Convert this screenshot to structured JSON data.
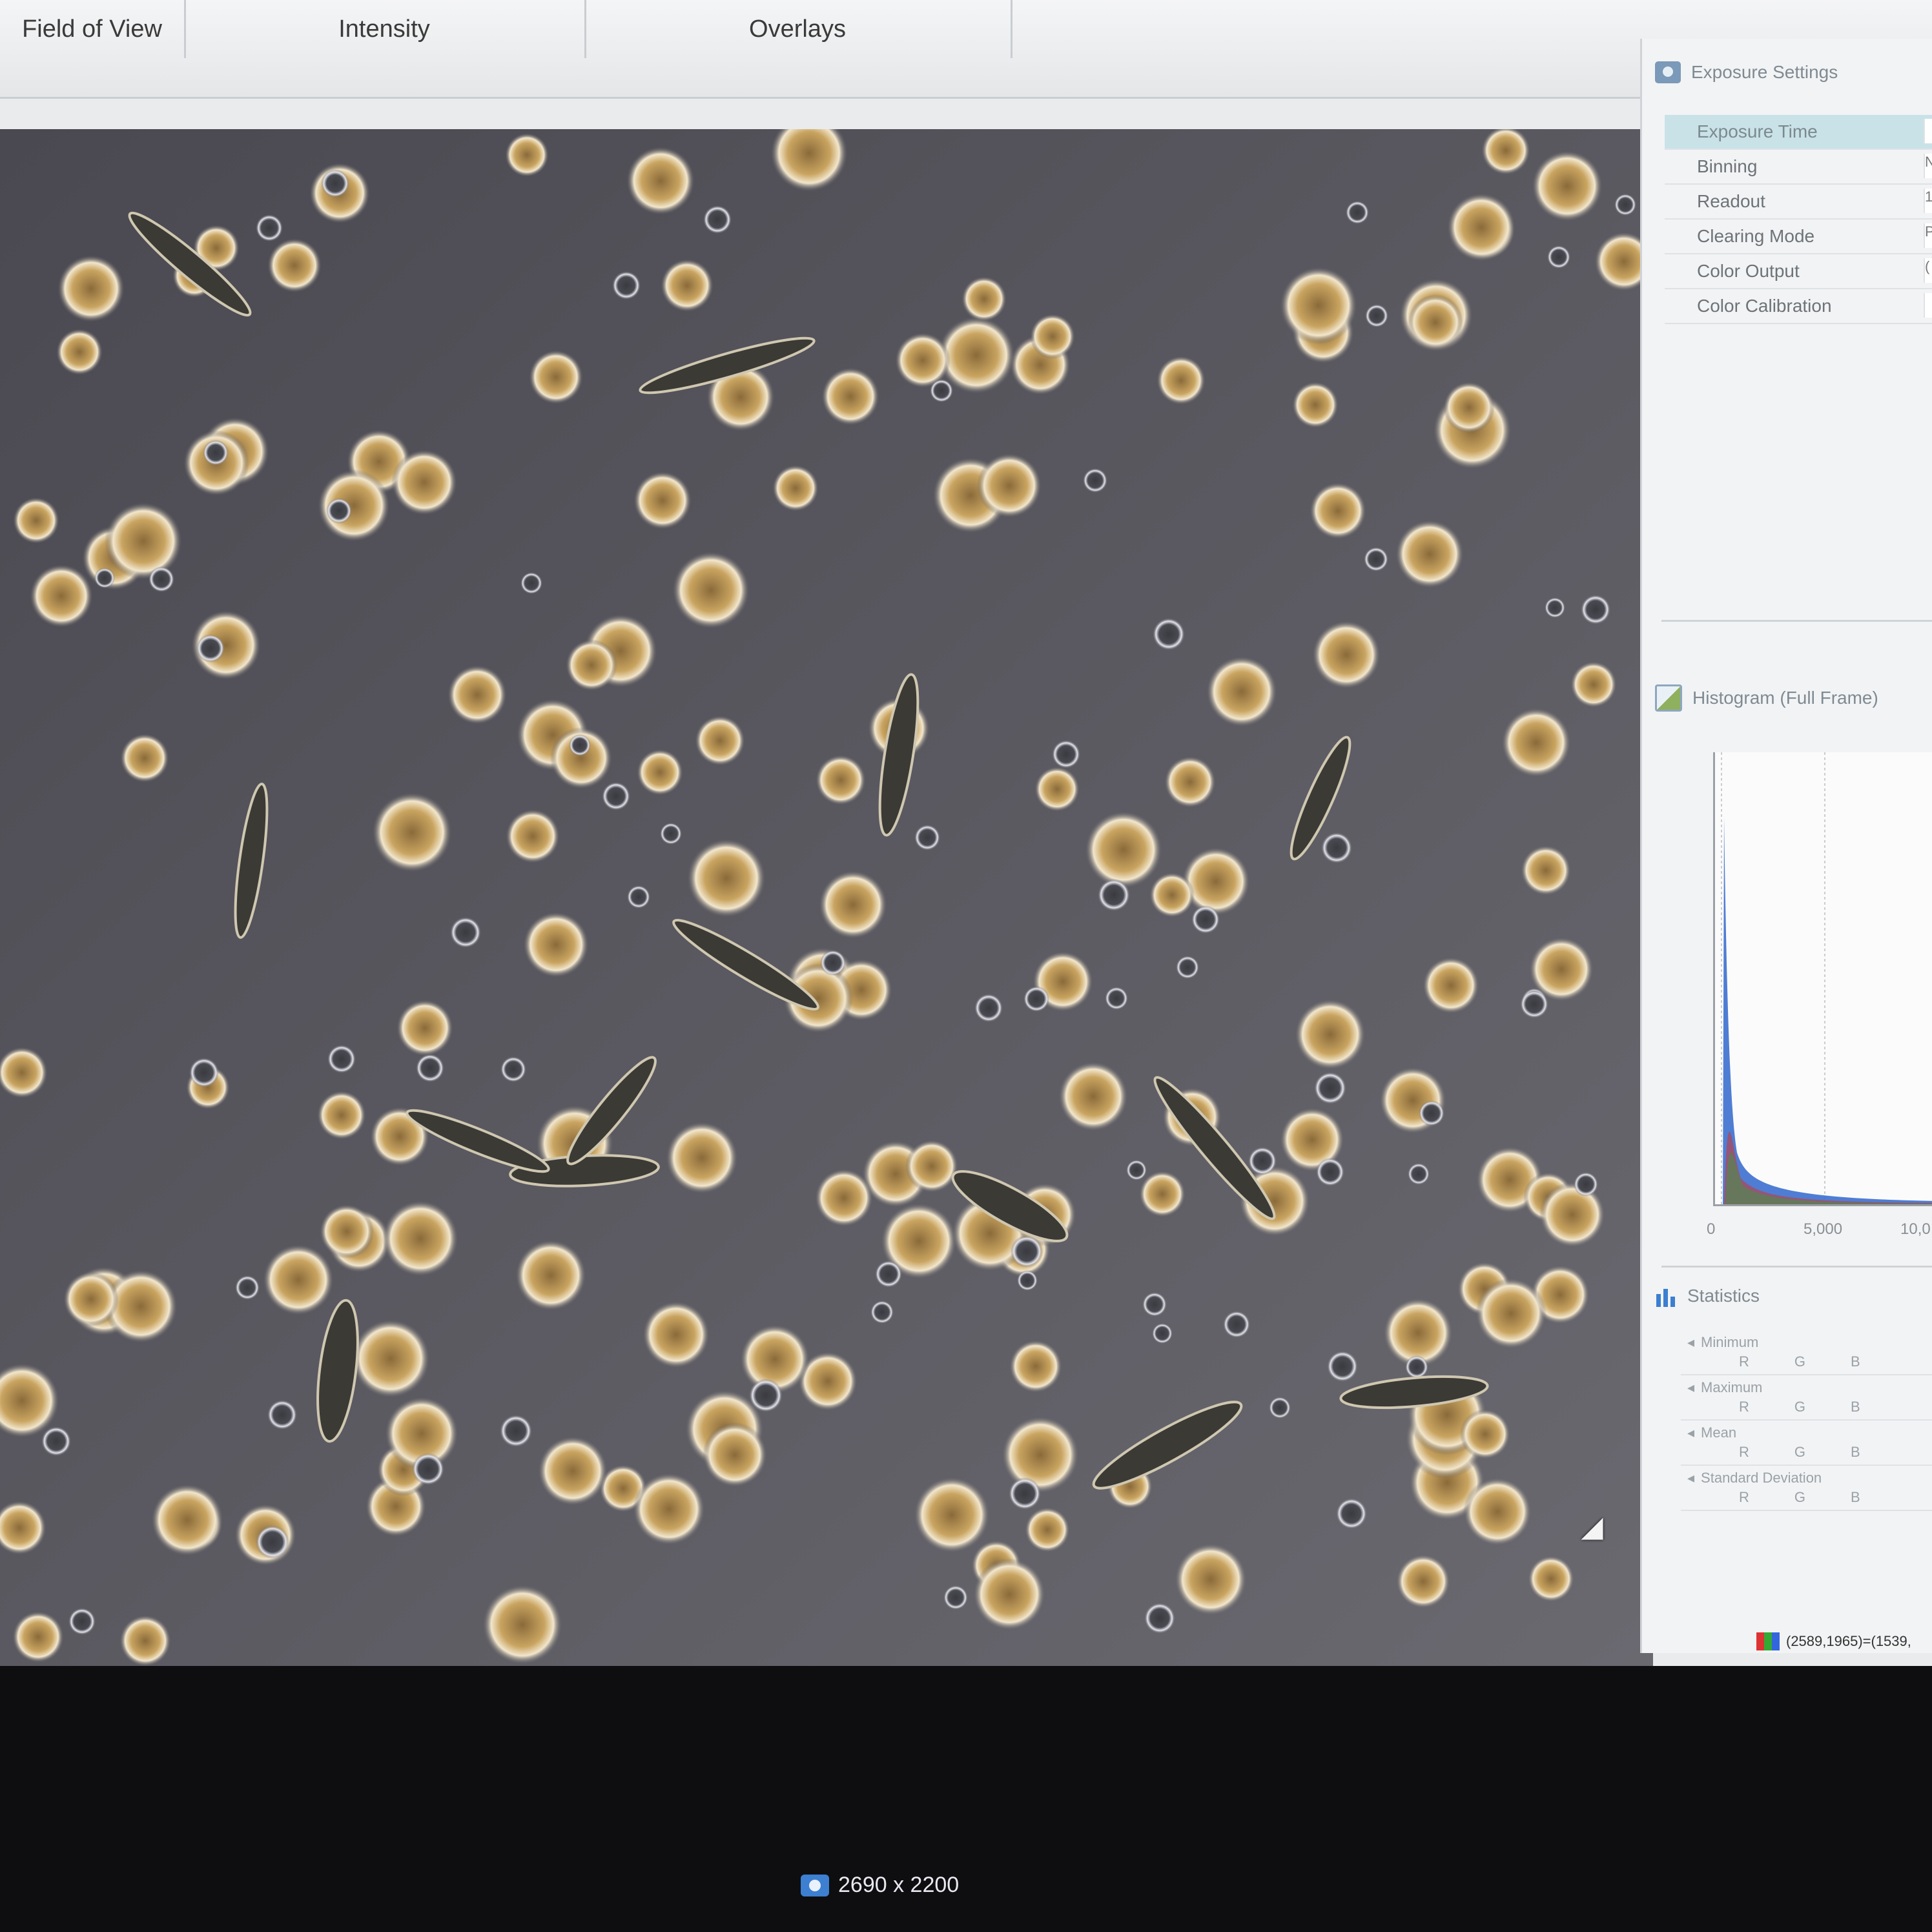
{
  "ribbon": {
    "tabs": [
      "Field of View",
      "Intensity",
      "Overlays"
    ]
  },
  "image": {
    "size_label": "2690 x 2200"
  },
  "exposure_settings": {
    "title": "Exposure Settings",
    "properties": [
      {
        "label": "Exposure Time",
        "value": "",
        "selected": true
      },
      {
        "label": "Binning",
        "value": "N"
      },
      {
        "label": "Readout",
        "value": "1"
      },
      {
        "label": "Clearing Mode",
        "value": "P"
      },
      {
        "label": "Color Output",
        "value": "("
      },
      {
        "label": "Color Calibration",
        "value": ""
      }
    ]
  },
  "histogram": {
    "title": "Histogram (Full Frame)",
    "x_ticks": [
      "0",
      "5,000",
      "10,0"
    ]
  },
  "statistics": {
    "title": "Statistics",
    "groups": [
      {
        "name": "Minimum",
        "cols": [
          "R",
          "G",
          "B"
        ]
      },
      {
        "name": "Maximum",
        "cols": [
          "R",
          "G",
          "B"
        ]
      },
      {
        "name": "Mean",
        "cols": [
          "R",
          "G",
          "B"
        ]
      },
      {
        "name": "Standard Deviation",
        "cols": [
          "R",
          "G",
          "B"
        ]
      }
    ]
  },
  "status": {
    "coords": "(2589,1965)=(1539,"
  },
  "colors": {
    "viewport_bg": "#5b5a60",
    "selected_row": "#c9e2e7",
    "accent": "#3b7fd0"
  }
}
